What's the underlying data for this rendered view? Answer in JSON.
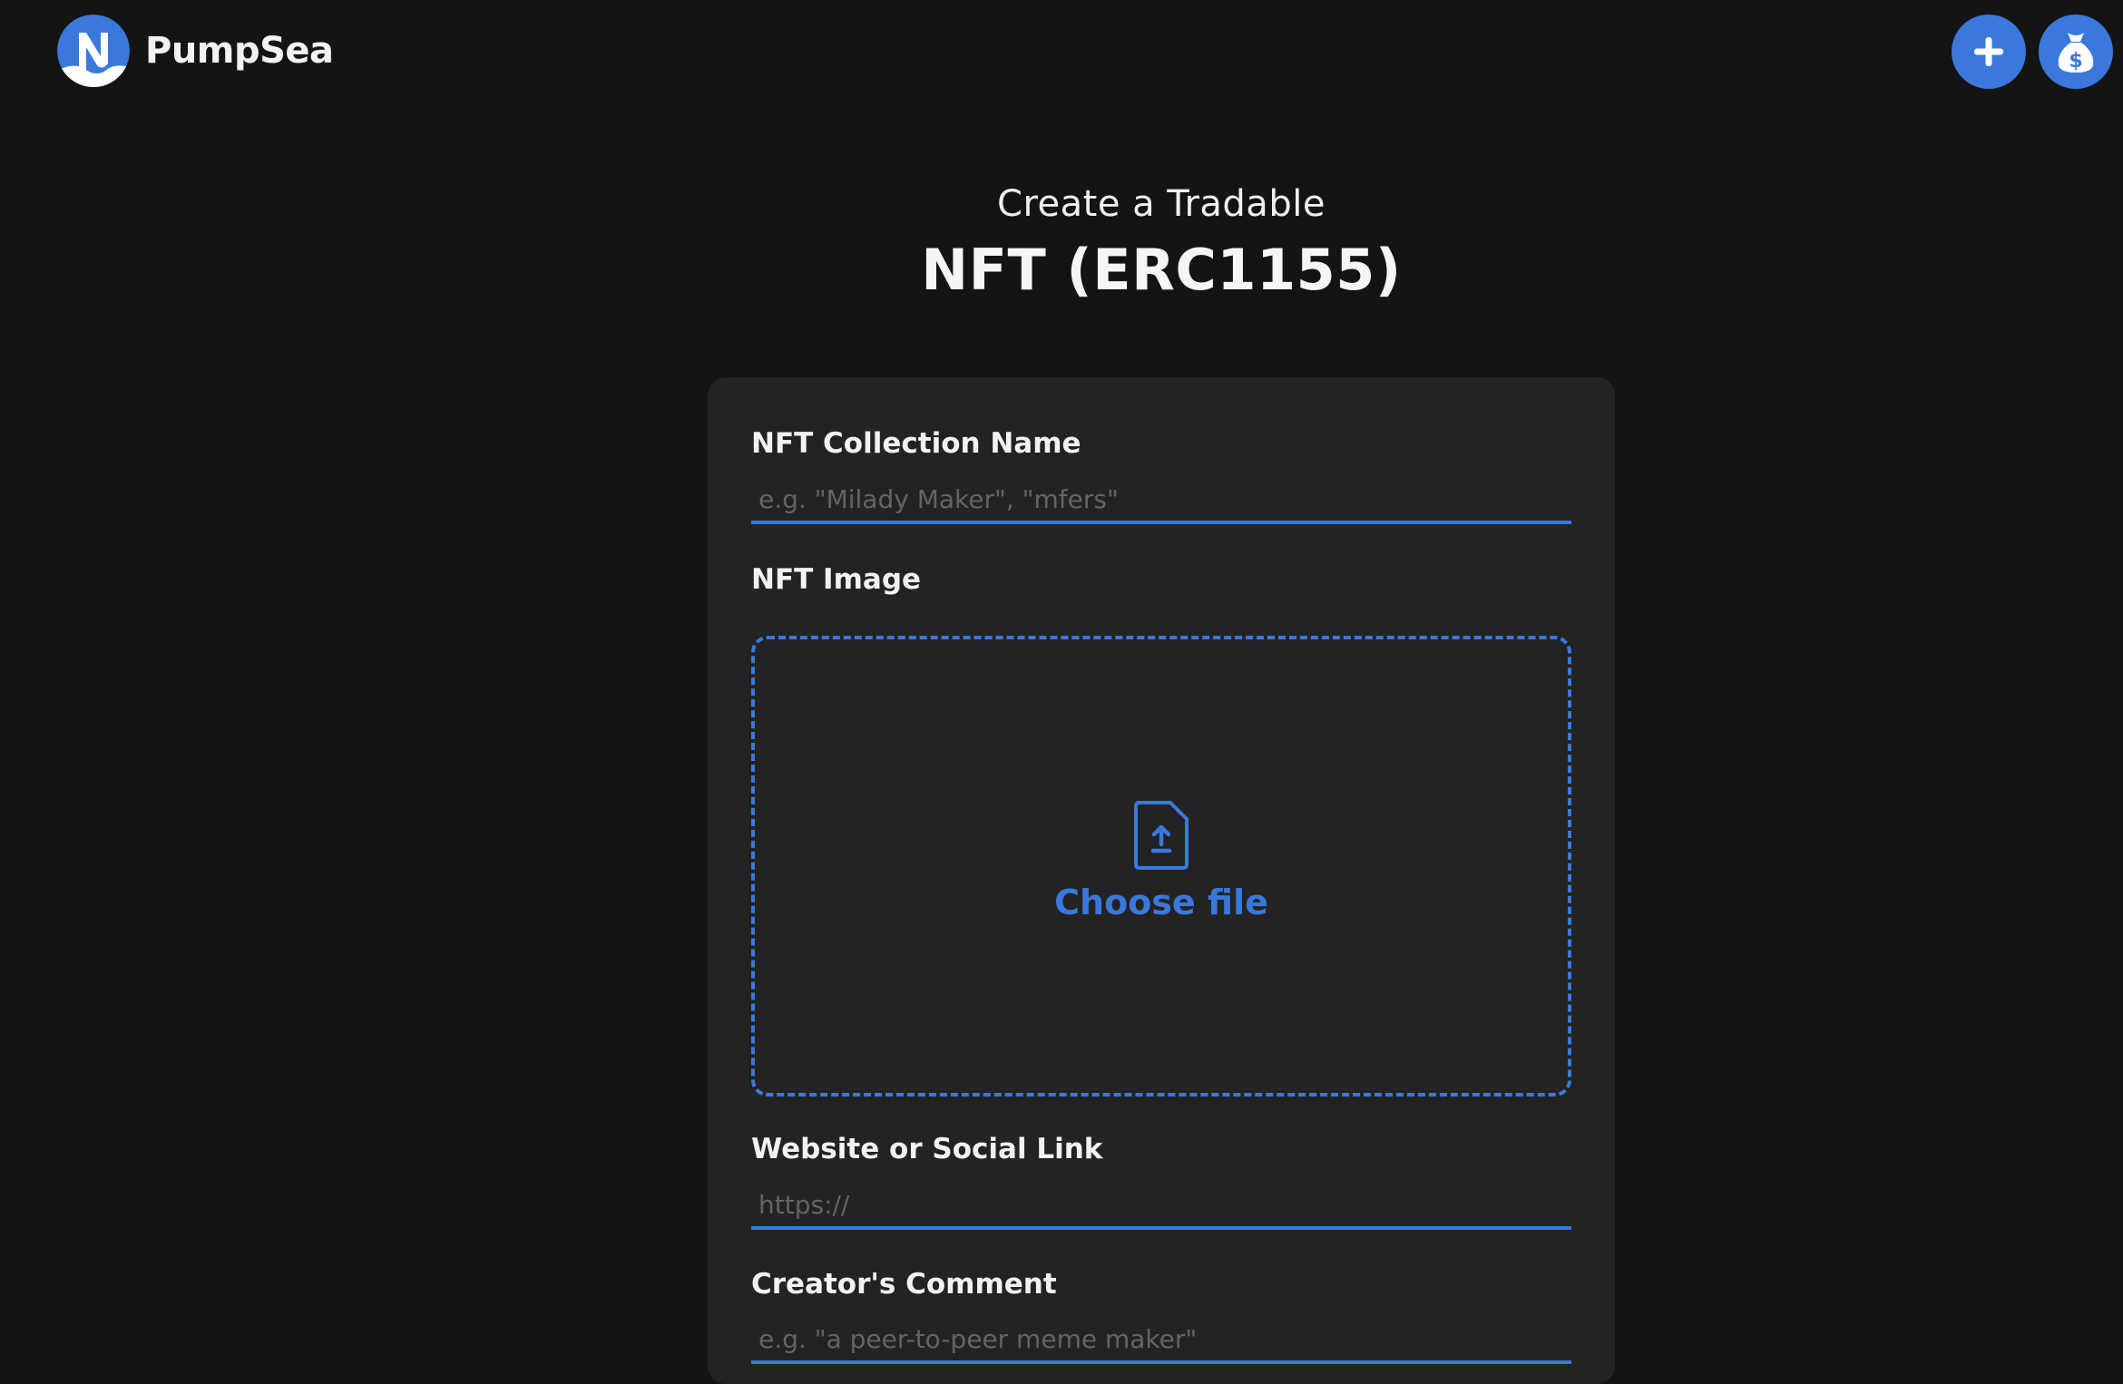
{
  "header": {
    "brand_name": "PumpSea",
    "logo_letter": "N",
    "accent_color": "#3a78db",
    "create_icon": "plus-icon",
    "wallet_icon": "money-bag-icon"
  },
  "title": {
    "line1": "Create a Tradable",
    "line2": "NFT (ERC1155)"
  },
  "form": {
    "collection_name": {
      "label": "NFT Collection Name",
      "placeholder": "e.g. \"Milady Maker\", \"mfers\"",
      "value": ""
    },
    "image": {
      "label": "NFT Image",
      "choose_file_label": "Choose file",
      "icon": "file-upload-icon"
    },
    "website": {
      "label": "Website or Social Link",
      "placeholder": "https://",
      "value": ""
    },
    "comment": {
      "label": "Creator's Comment",
      "placeholder": "e.g. \"a peer-to-peer meme maker\"",
      "value": ""
    }
  }
}
